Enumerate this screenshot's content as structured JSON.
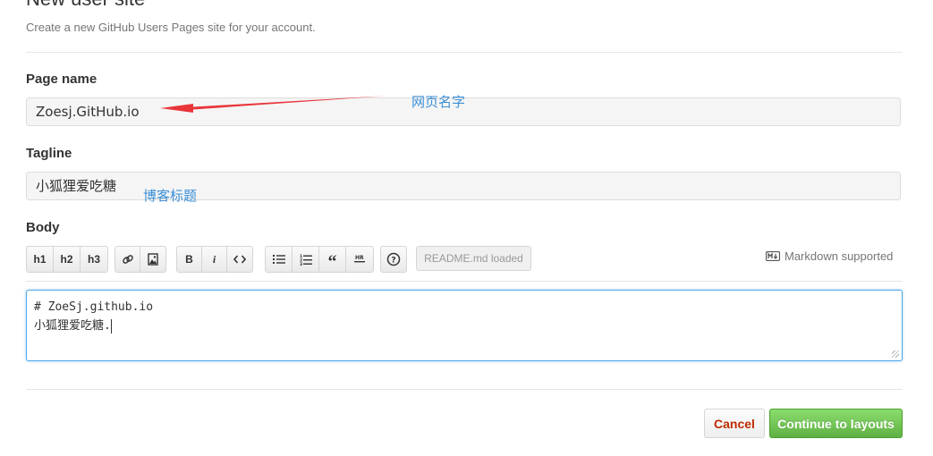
{
  "header": {
    "title": "New user site",
    "subtitle": "Create a new GitHub Users Pages site for your account."
  },
  "page_name": {
    "label": "Page name",
    "value": "Zoesj.GitHub.io",
    "annotation": "网页名字"
  },
  "tagline": {
    "label": "Tagline",
    "value": "小狐狸爱吃糖",
    "annotation": "博客标题"
  },
  "body": {
    "label": "Body",
    "toolbar": {
      "h1": "h1",
      "h2": "h2",
      "h3": "h3",
      "bold": "B",
      "italic": "i",
      "readme": "README.md loaded"
    },
    "markdown_note": "Markdown supported",
    "content_line1": "# ZoeSj.github.io",
    "content_line2": "小狐狸爱吃糖."
  },
  "actions": {
    "cancel": "Cancel",
    "continue": "Continue to layouts"
  },
  "colors": {
    "annotation": "#3a8fd6",
    "arrow": "#e8363a",
    "continue_button": "#6cc644",
    "cancel_text": "#bd2c00",
    "focus_border": "#51a7e8"
  }
}
